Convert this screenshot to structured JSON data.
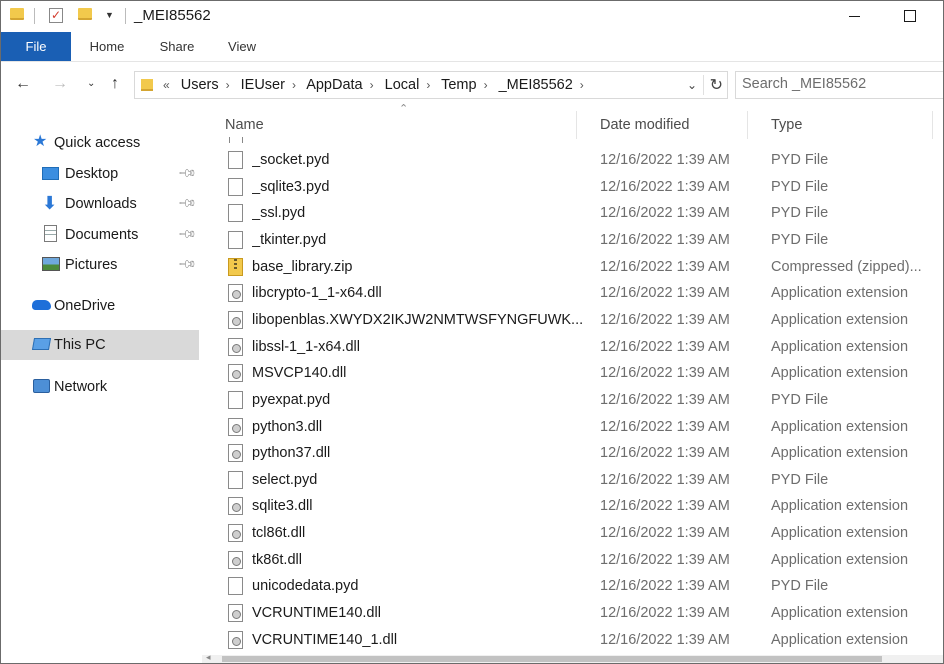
{
  "window": {
    "title": "_MEI85562"
  },
  "ribbon": {
    "tabs": [
      "File",
      "Home",
      "Share",
      "View"
    ]
  },
  "address": {
    "crumbs": [
      "Users",
      "IEUser",
      "AppData",
      "Local",
      "Temp",
      "_MEI85562"
    ],
    "prefix": "«"
  },
  "search": {
    "placeholder": "Search _MEI85562"
  },
  "sidebar": {
    "items": [
      {
        "label": "Quick access",
        "icon": "star-icon",
        "pinned": false
      },
      {
        "label": "Desktop",
        "icon": "desktop-icon",
        "pinned": true
      },
      {
        "label": "Downloads",
        "icon": "download-icon",
        "pinned": true
      },
      {
        "label": "Documents",
        "icon": "documents-icon",
        "pinned": true
      },
      {
        "label": "Pictures",
        "icon": "pictures-icon",
        "pinned": true
      },
      {
        "label": "OneDrive",
        "icon": "cloud-icon",
        "pinned": false
      },
      {
        "label": "This PC",
        "icon": "computer-icon",
        "pinned": false,
        "selected": true
      },
      {
        "label": "Network",
        "icon": "network-icon",
        "pinned": false
      }
    ]
  },
  "columns": {
    "name": "Name",
    "date": "Date modified",
    "type": "Type"
  },
  "files": [
    {
      "name": "_socket.pyd",
      "date": "12/16/2022 1:39 AM",
      "type": "PYD File",
      "kind": "pyd"
    },
    {
      "name": "_sqlite3.pyd",
      "date": "12/16/2022 1:39 AM",
      "type": "PYD File",
      "kind": "pyd"
    },
    {
      "name": "_ssl.pyd",
      "date": "12/16/2022 1:39 AM",
      "type": "PYD File",
      "kind": "pyd"
    },
    {
      "name": "_tkinter.pyd",
      "date": "12/16/2022 1:39 AM",
      "type": "PYD File",
      "kind": "pyd"
    },
    {
      "name": "base_library.zip",
      "date": "12/16/2022 1:39 AM",
      "type": "Compressed (zipped)...",
      "kind": "zip"
    },
    {
      "name": "libcrypto-1_1-x64.dll",
      "date": "12/16/2022 1:39 AM",
      "type": "Application extension",
      "kind": "dll"
    },
    {
      "name": "libopenblas.XWYDX2IKJW2NMTWSFYNGFUWK...",
      "date": "12/16/2022 1:39 AM",
      "type": "Application extension",
      "kind": "dll"
    },
    {
      "name": "libssl-1_1-x64.dll",
      "date": "12/16/2022 1:39 AM",
      "type": "Application extension",
      "kind": "dll"
    },
    {
      "name": "MSVCP140.dll",
      "date": "12/16/2022 1:39 AM",
      "type": "Application extension",
      "kind": "dll"
    },
    {
      "name": "pyexpat.pyd",
      "date": "12/16/2022 1:39 AM",
      "type": "PYD File",
      "kind": "pyd"
    },
    {
      "name": "python3.dll",
      "date": "12/16/2022 1:39 AM",
      "type": "Application extension",
      "kind": "dll"
    },
    {
      "name": "python37.dll",
      "date": "12/16/2022 1:39 AM",
      "type": "Application extension",
      "kind": "dll"
    },
    {
      "name": "select.pyd",
      "date": "12/16/2022 1:39 AM",
      "type": "PYD File",
      "kind": "pyd"
    },
    {
      "name": "sqlite3.dll",
      "date": "12/16/2022 1:39 AM",
      "type": "Application extension",
      "kind": "dll"
    },
    {
      "name": "tcl86t.dll",
      "date": "12/16/2022 1:39 AM",
      "type": "Application extension",
      "kind": "dll"
    },
    {
      "name": "tk86t.dll",
      "date": "12/16/2022 1:39 AM",
      "type": "Application extension",
      "kind": "dll"
    },
    {
      "name": "unicodedata.pyd",
      "date": "12/16/2022 1:39 AM",
      "type": "PYD File",
      "kind": "pyd"
    },
    {
      "name": "VCRUNTIME140.dll",
      "date": "12/16/2022 1:39 AM",
      "type": "Application extension",
      "kind": "dll"
    },
    {
      "name": "VCRUNTIME140_1.dll",
      "date": "12/16/2022 1:39 AM",
      "type": "Application extension",
      "kind": "dll"
    }
  ],
  "colors": {
    "file_tab": "#1a5fb4",
    "selected_nav": "#d9d9d9",
    "folder": "#f2c94c"
  }
}
